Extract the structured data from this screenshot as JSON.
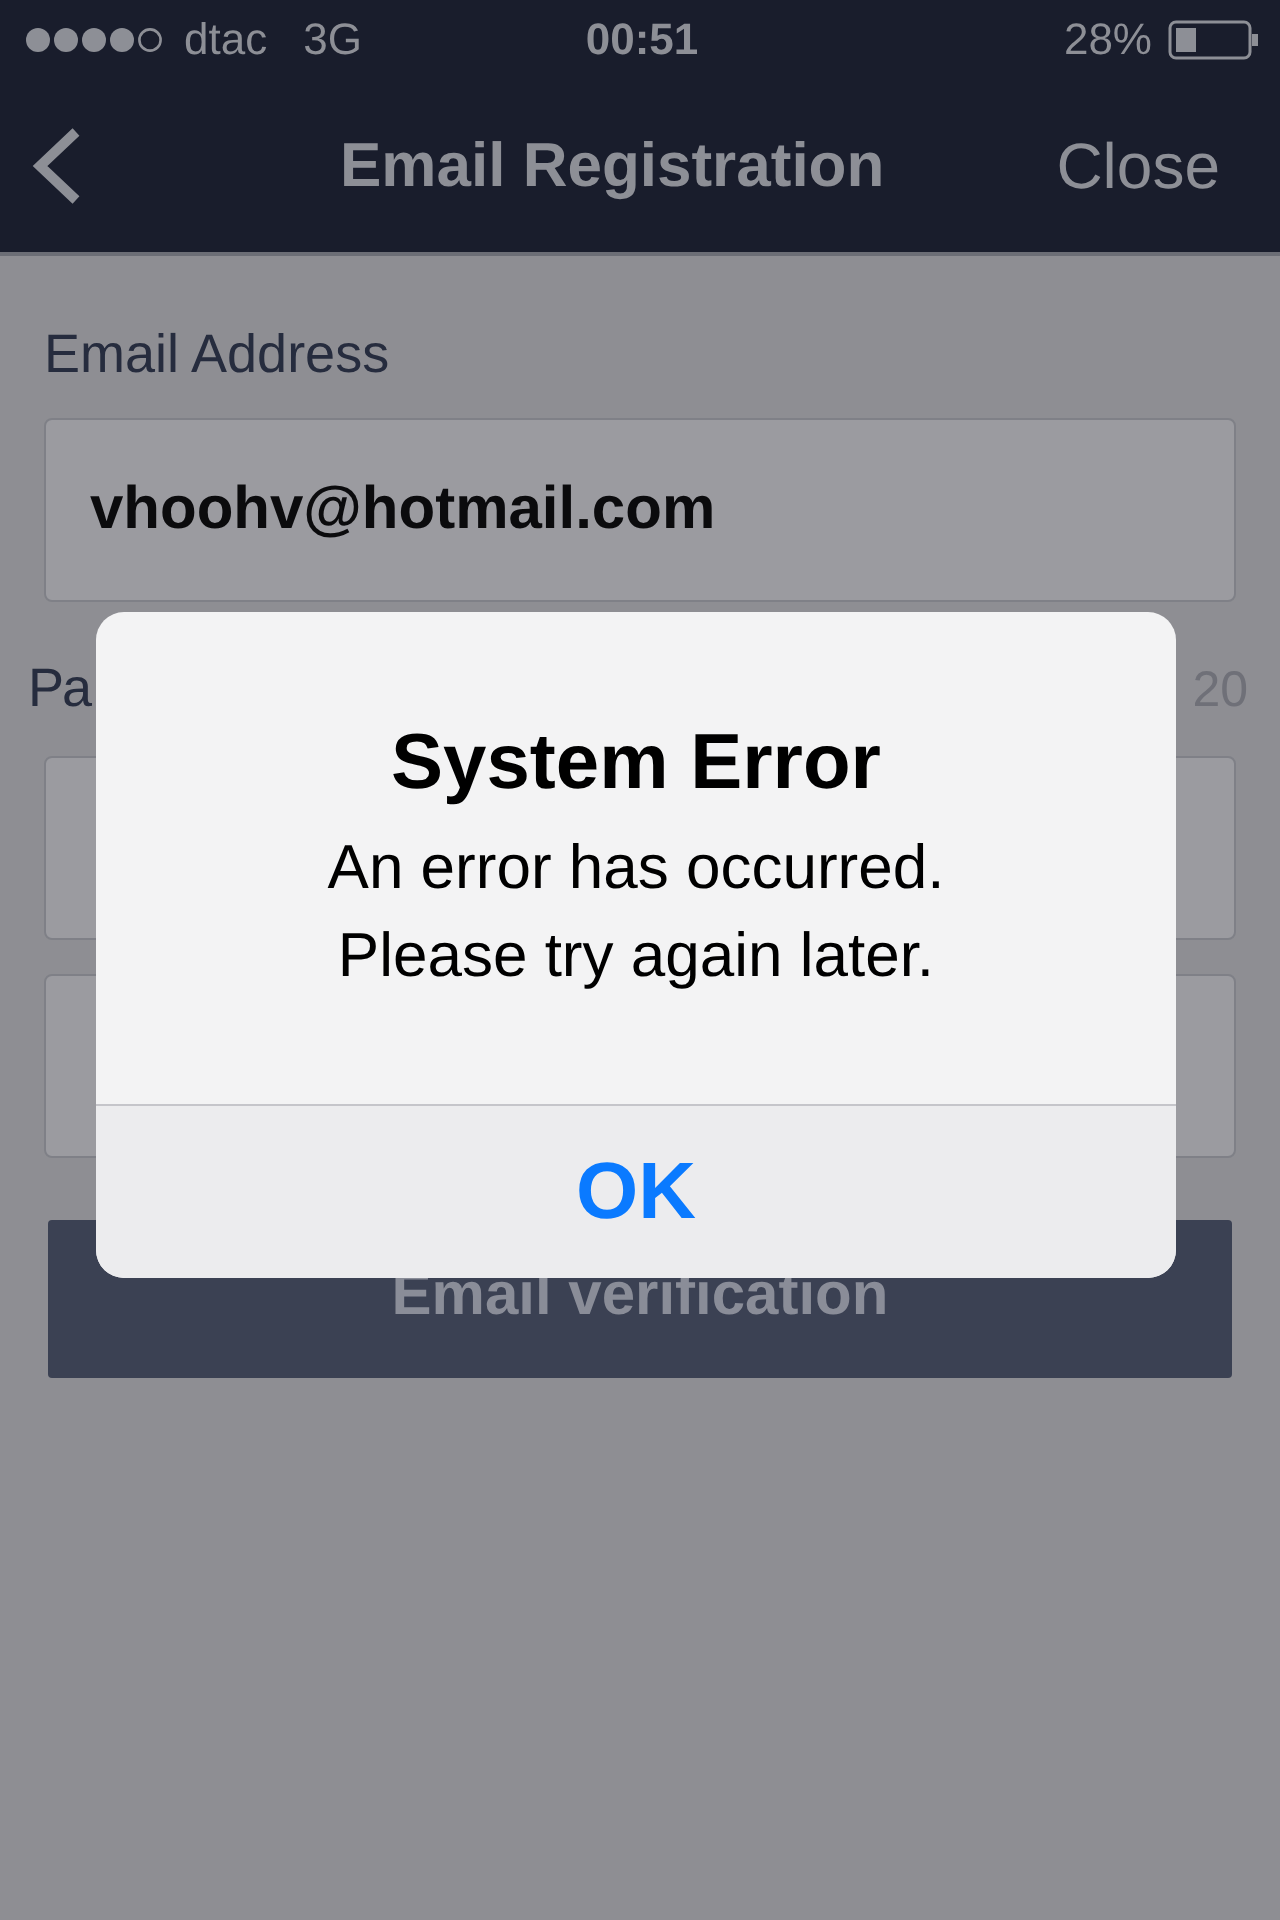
{
  "status_bar": {
    "carrier": "dtac",
    "network": "3G",
    "time": "00:51",
    "battery": "28%"
  },
  "nav": {
    "title": "Email Registration",
    "close": "Close"
  },
  "form": {
    "email_label": "Email Address",
    "email_value": "vhoohv@hotmail.com",
    "password_label": "Pa",
    "counter": "20",
    "button": "Email verification"
  },
  "alert": {
    "title": "System Error",
    "message": [
      "An error has occurred.",
      "Please try again later."
    ],
    "button": "OK"
  }
}
